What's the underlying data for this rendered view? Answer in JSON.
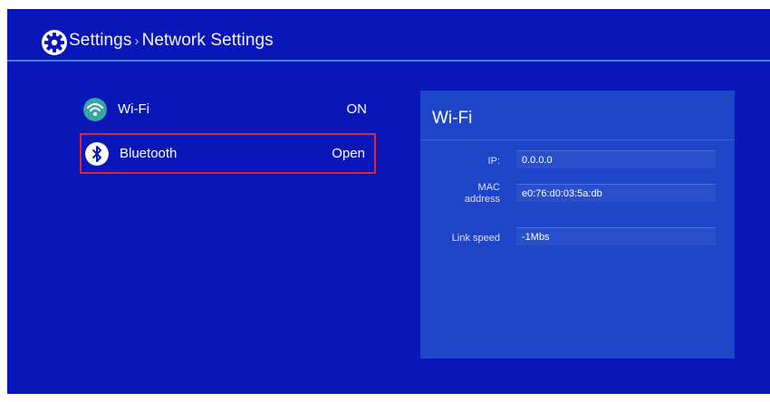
{
  "header": {
    "section": "Settings",
    "separator": "›",
    "page": "Network Settings"
  },
  "menu": {
    "items": [
      {
        "label": "Wi-Fi",
        "value": "ON",
        "icon": "wifi-icon"
      },
      {
        "label": "Bluetooth",
        "value": "Open",
        "icon": "bluetooth-icon",
        "selected": true
      }
    ]
  },
  "panel": {
    "title": "Wi-Fi",
    "rows": [
      {
        "label": "IP:",
        "value": "0.0.0.0"
      },
      {
        "label": "MAC address",
        "value": "e0:76:d0:03:5a:db"
      },
      {
        "label": "Link speed",
        "value": "-1Mbs"
      }
    ]
  },
  "colors": {
    "background": "#0a17b8",
    "panel": "#1e44c8",
    "accent_line": "#3f7fe0",
    "selection_border": "#e0232f",
    "wifi_icon": "#3aa6a0"
  }
}
